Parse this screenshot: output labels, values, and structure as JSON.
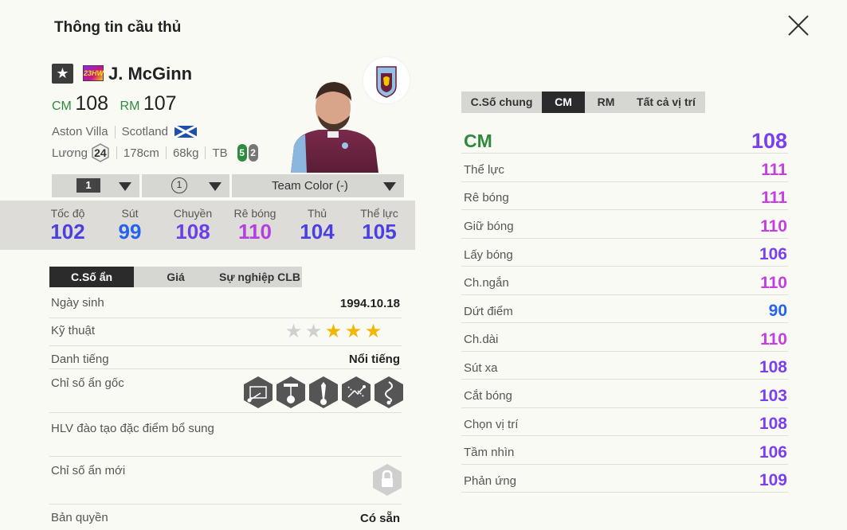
{
  "header": {
    "title": "Thông tin cầu thủ"
  },
  "player": {
    "name": "J. McGinn",
    "season_badge": "23HW",
    "positions": [
      {
        "pos": "CM",
        "ovr": "108"
      },
      {
        "pos": "RM",
        "ovr": "107"
      }
    ],
    "club": "Aston Villa",
    "nation": "Scotland",
    "wage_label": "Lương",
    "wage": "24",
    "height": "178cm",
    "weight": "68kg",
    "body_type": "TB",
    "weak_foot": "5",
    "skill_foot": "2"
  },
  "dropdowns": {
    "level": "1",
    "training": "1",
    "team_color": "Team Color (-)"
  },
  "main_stats": [
    {
      "label": "Tốc độ",
      "value": "102",
      "color": "#4a3fe0"
    },
    {
      "label": "Sút",
      "value": "99",
      "color": "#2563eb"
    },
    {
      "label": "Chuyền",
      "value": "108",
      "color": "#6a3fe8"
    },
    {
      "label": "Rê bóng",
      "value": "110",
      "color": "#b43fe0"
    },
    {
      "label": "Thủ",
      "value": "104",
      "color": "#4a3fe0"
    },
    {
      "label": "Thể lực",
      "value": "105",
      "color": "#4a3fe0"
    }
  ],
  "tabs": [
    "C.Số ẩn",
    "Giá",
    "Sự nghiệp CLB"
  ],
  "details": {
    "birth_label": "Ngày sinh",
    "birth": "1994.10.18",
    "skill_label": "Kỹ thuật",
    "skill_stars": 3,
    "skill_max": 5,
    "fame_label": "Danh tiếng",
    "fame": "Nổi tiếng",
    "traits_label": "Chỉ số ẩn gốc",
    "coach_label": "HLV đào tạo đặc điểm bổ sung",
    "new_traits_label": "Chỉ số ẩn mới",
    "license_label": "Bản quyền",
    "license": "Có sẵn"
  },
  "traits_icons": [
    "long-shot-trait-icon",
    "power-header-trait-icon",
    "speed-dribbler-trait-icon",
    "playmaker-trait-icon",
    "dribble-trait-icon"
  ],
  "right_tabs": [
    "C.Số chung",
    "CM",
    "RM",
    "Tất cả vị trí"
  ],
  "position_detail": {
    "pos": "CM",
    "ovr": "108"
  },
  "position_stats": [
    {
      "label": "Thể lực",
      "value": "111",
      "color": "#c43ee0"
    },
    {
      "label": "Rê bóng",
      "value": "111",
      "color": "#c43ee0"
    },
    {
      "label": "Giữ bóng",
      "value": "110",
      "color": "#c43ee0"
    },
    {
      "label": "Lấy bóng",
      "value": "106",
      "color": "#7a3ff0"
    },
    {
      "label": "Ch.ngắn",
      "value": "110",
      "color": "#c43ee0"
    },
    {
      "label": "Dứt điểm",
      "value": "90",
      "color": "#2563eb"
    },
    {
      "label": "Ch.dài",
      "value": "110",
      "color": "#c43ee0"
    },
    {
      "label": "Sút xa",
      "value": "108",
      "color": "#7a3ff0"
    },
    {
      "label": "Cắt bóng",
      "value": "103",
      "color": "#7a3ff0"
    },
    {
      "label": "Chọn vị trí",
      "value": "108",
      "color": "#7a3ff0"
    },
    {
      "label": "Tầm nhìn",
      "value": "106",
      "color": "#7a3ff0"
    },
    {
      "label": "Phản ứng",
      "value": "109",
      "color": "#7a3ff0"
    }
  ]
}
